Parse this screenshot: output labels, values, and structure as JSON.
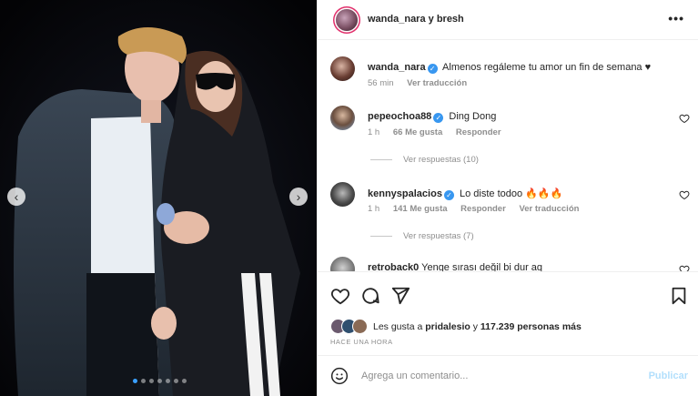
{
  "post": {
    "header_title": "wanda_nara y bresh",
    "carousel": {
      "slide_count": 7,
      "active_index": 0
    }
  },
  "caption": {
    "username": "wanda_nara",
    "text": "Almenos regáleme tu amor un fin de semana ♥",
    "time": "56 min",
    "translate": "Ver traducción"
  },
  "comments": [
    {
      "username": "pepeochoa88",
      "verified": true,
      "text": "Ding Dong",
      "time": "1 h",
      "likes": "66 Me gusta",
      "reply": "Responder",
      "view_replies": "Ver respuestas (10)"
    },
    {
      "username": "kennyspalacios",
      "verified": true,
      "text": "Lo diste todoo 🔥🔥🔥",
      "time": "1 h",
      "likes": "141 Me gusta",
      "reply": "Responder",
      "translate": "Ver traducción",
      "view_replies": "Ver respuestas (7)"
    },
    {
      "username": "retroback0",
      "verified": false,
      "text": "Yenge sırası değil bi dur aq"
    }
  ],
  "likes": {
    "prefix": "Les gusta a",
    "user": "pridalesio",
    "middle": "y",
    "count_text": "117.239 personas más"
  },
  "time_ago": "HACE UNA HORA",
  "add_comment": {
    "placeholder": "Agrega un comentario...",
    "publish": "Publicar"
  },
  "colors": {
    "verified": "#3897f0",
    "publish_disabled": "#b2dffc",
    "active_dot": "#3aa0ff",
    "story_ring": "#e1306c"
  },
  "icons": [
    "chevron-left-icon",
    "chevron-right-icon",
    "more-icon",
    "heart-icon",
    "comment-icon",
    "share-icon",
    "bookmark-icon",
    "emoji-icon",
    "verified-icon"
  ]
}
